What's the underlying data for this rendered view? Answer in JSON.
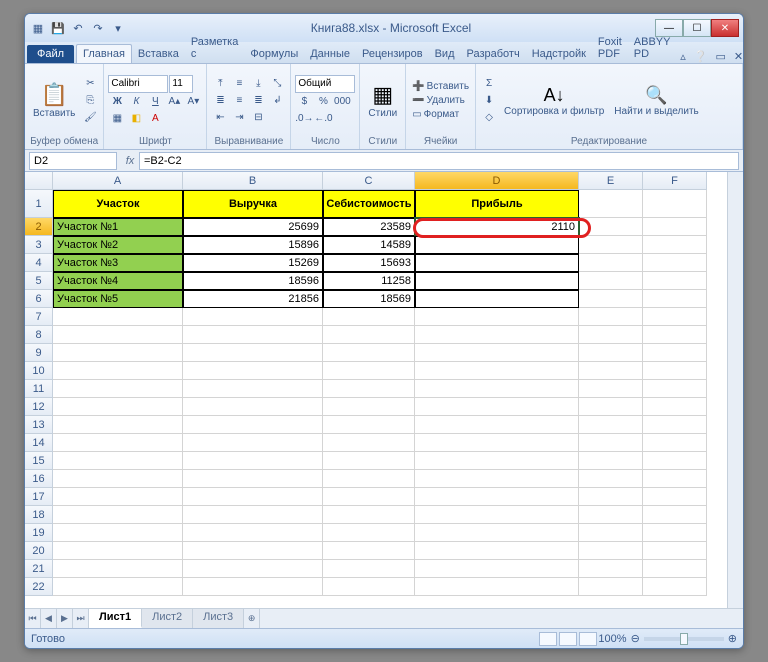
{
  "title": "Книга88.xlsx - Microsoft Excel",
  "tabs": {
    "file": "Файл",
    "list": [
      "Главная",
      "Вставка",
      "Разметка с",
      "Формулы",
      "Данные",
      "Рецензиров",
      "Вид",
      "Разработч",
      "Надстройк",
      "Foxit PDF",
      "ABBYY PD"
    ]
  },
  "ribbon": {
    "paste": "Вставить",
    "clipboard": "Буфер обмена",
    "font_name": "Calibri",
    "font_size": "11",
    "font": "Шрифт",
    "align": "Выравнивание",
    "numfmt": "Общий",
    "number": "Число",
    "styles": "Стили",
    "styles_btn": "Стили",
    "insert": "Вставить",
    "delete": "Удалить",
    "format": "Формат",
    "cells": "Ячейки",
    "sort": "Сортировка и фильтр",
    "find": "Найти и выделить",
    "editing": "Редактирование"
  },
  "namebox": "D2",
  "formula": "=B2-C2",
  "cols": [
    "A",
    "B",
    "C",
    "D",
    "E",
    "F"
  ],
  "headers": [
    "Участок",
    "Выручка",
    "Себистоимость",
    "Прибыль"
  ],
  "rows": [
    {
      "a": "Участок №1",
      "b": "25699",
      "c": "23589",
      "d": "2110"
    },
    {
      "a": "Участок №2",
      "b": "15896",
      "c": "14589",
      "d": ""
    },
    {
      "a": "Участок №3",
      "b": "15269",
      "c": "15693",
      "d": ""
    },
    {
      "a": "Участок №4",
      "b": "18596",
      "c": "11258",
      "d": ""
    },
    {
      "a": "Участок №5",
      "b": "21856",
      "c": "18569",
      "d": ""
    }
  ],
  "sheets": [
    "Лист1",
    "Лист2",
    "Лист3"
  ],
  "status": "Готово",
  "zoom": "100%"
}
